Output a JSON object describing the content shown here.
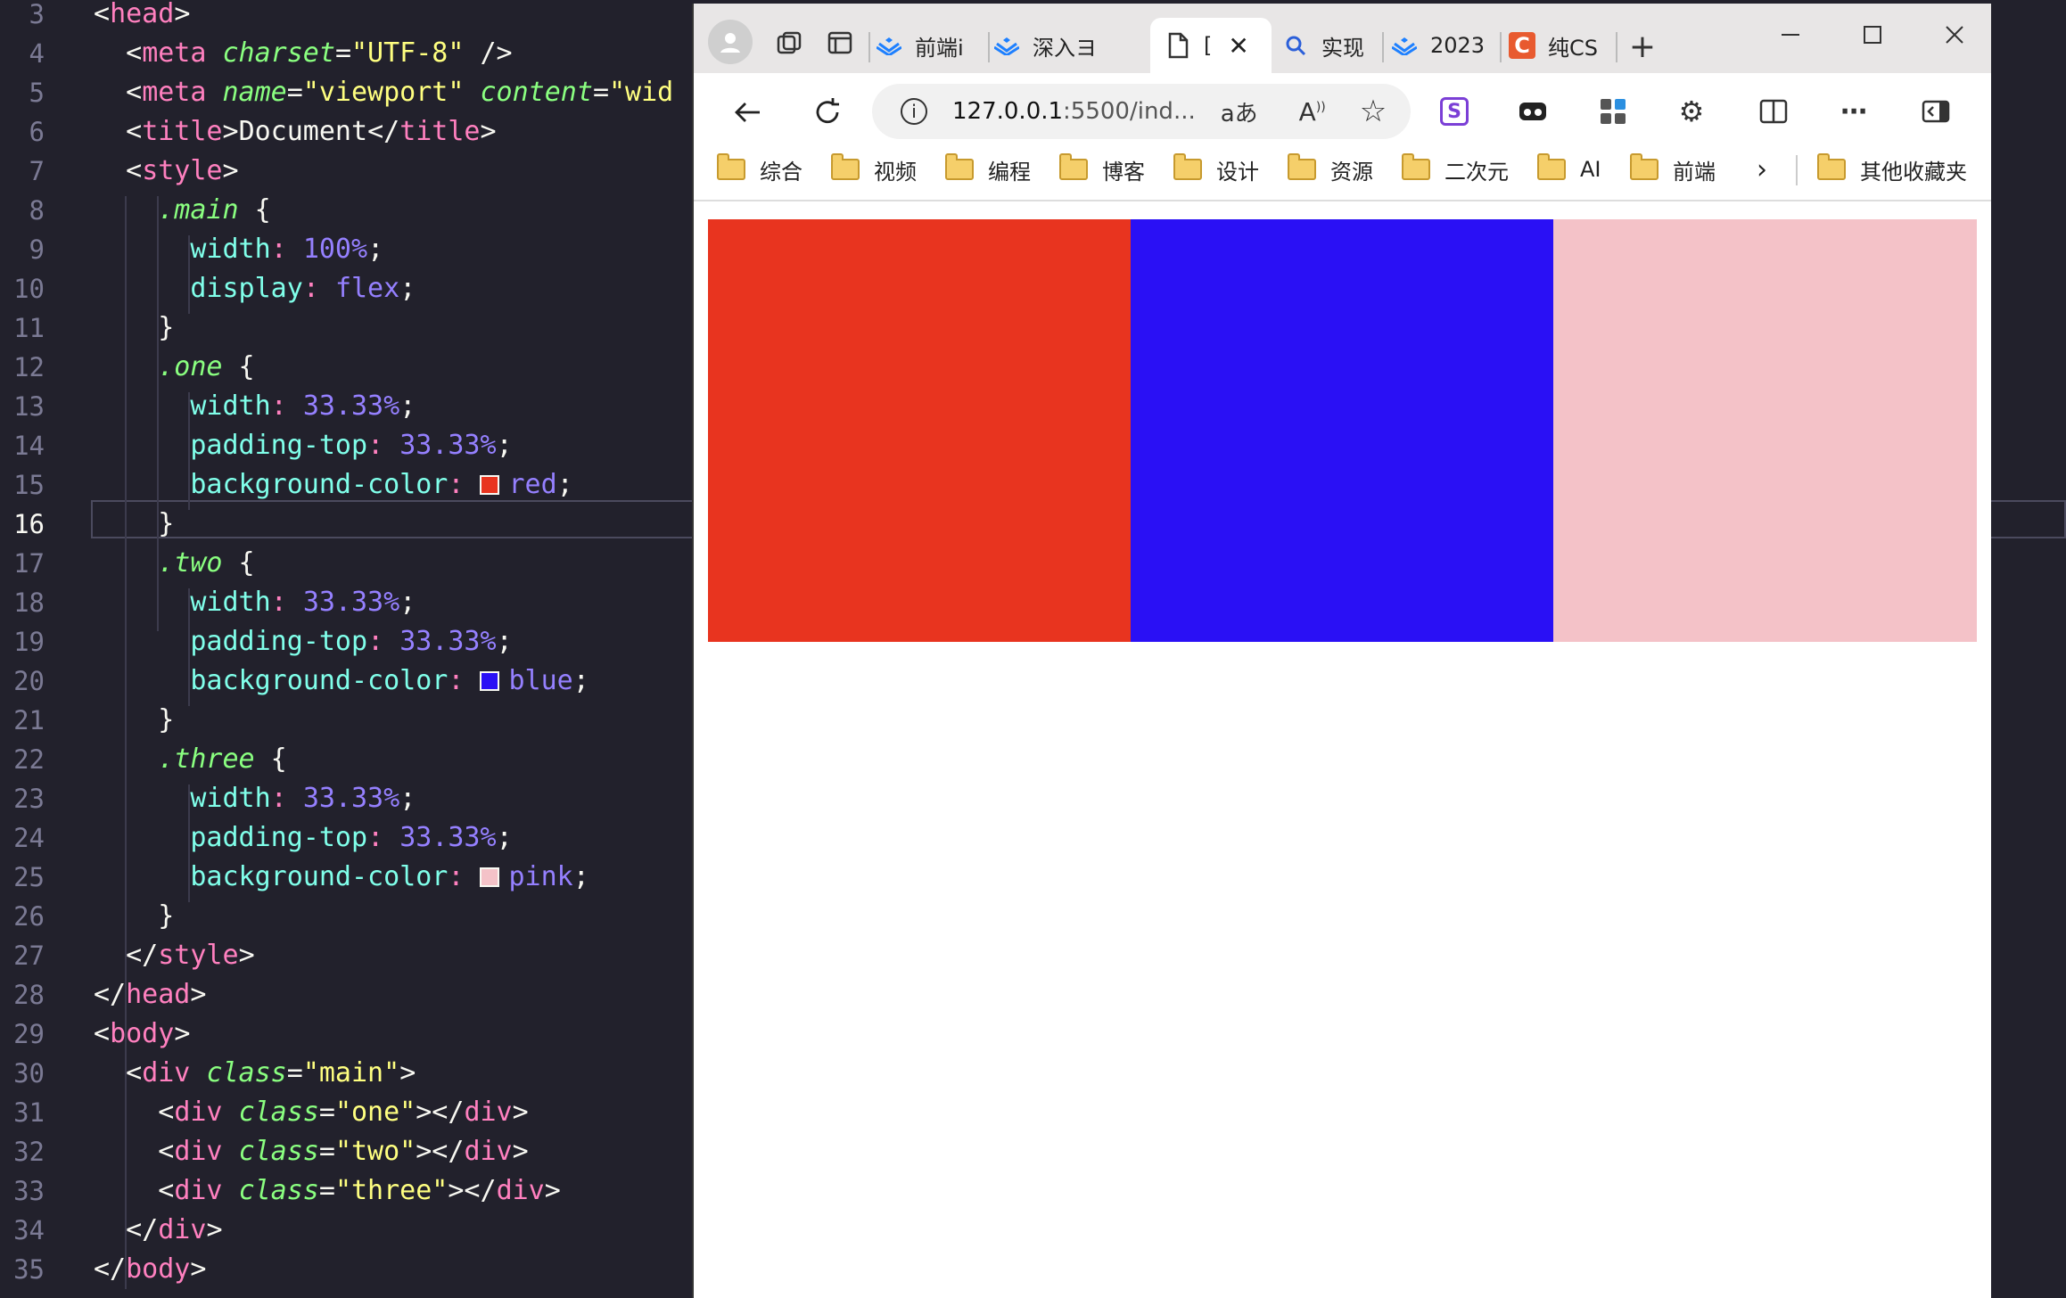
{
  "editor": {
    "lines": [
      {
        "n": "3",
        "html": "<span class='pun'>&lt;</span><span class='tag'>head</span><span class='pun'>&gt;</span>"
      },
      {
        "n": "4",
        "html": "  <span class='pun'>&lt;</span><span class='tag'>meta</span> <span class='attr'>charset</span><span class='pun'>=</span><span class='str'>\"UTF-8\"</span> <span class='pun'>/&gt;</span>"
      },
      {
        "n": "5",
        "html": "  <span class='pun'>&lt;</span><span class='tag'>meta</span> <span class='attr'>name</span><span class='pun'>=</span><span class='str'>\"viewport\"</span> <span class='attr'>content</span><span class='pun'>=</span><span class='str'>\"wid</span>"
      },
      {
        "n": "6",
        "html": "  <span class='pun'>&lt;</span><span class='tag'>title</span><span class='pun'>&gt;</span>Document<span class='pun'>&lt;/</span><span class='tag'>title</span><span class='pun'>&gt;</span>"
      },
      {
        "n": "7",
        "html": "  <span class='pun'>&lt;</span><span class='tag'>style</span><span class='pun'>&gt;</span>"
      },
      {
        "n": "8",
        "html": "    <span class='sel'>.main</span> {"
      },
      {
        "n": "9",
        "html": "      <span class='prop'>width</span><span class='tag'>:</span> <span class='num'>100%</span>;"
      },
      {
        "n": "10",
        "html": "      <span class='prop'>display</span><span class='tag'>:</span> <span class='kw'>flex</span>;"
      },
      {
        "n": "11",
        "html": "    }"
      },
      {
        "n": "12",
        "html": "    <span class='sel'>.one</span> {"
      },
      {
        "n": "13",
        "html": "      <span class='prop'>width</span><span class='tag'>:</span> <span class='num'>33.33%</span>;"
      },
      {
        "n": "14",
        "html": "      <span class='prop'>padding-top</span><span class='tag'>:</span> <span class='num'>33.33%</span>;"
      },
      {
        "n": "15",
        "html": "      <span class='prop'>background-color</span><span class='tag'>:</span> <span class='swatch' style='background:#e8341f'></span><span class='kw'>red</span>;"
      },
      {
        "n": "16",
        "html": "    }"
      },
      {
        "n": "17",
        "html": "    <span class='sel'>.two</span> {"
      },
      {
        "n": "18",
        "html": "      <span class='prop'>width</span><span class='tag'>:</span> <span class='num'>33.33%</span>;"
      },
      {
        "n": "19",
        "html": "      <span class='prop'>padding-top</span><span class='tag'>:</span> <span class='num'>33.33%</span>;"
      },
      {
        "n": "20",
        "html": "      <span class='prop'>background-color</span><span class='tag'>:</span> <span class='swatch' style='background:#2a10f5'></span><span class='kw'>blue</span>;"
      },
      {
        "n": "21",
        "html": "    }"
      },
      {
        "n": "22",
        "html": "    <span class='sel'>.three</span> {"
      },
      {
        "n": "23",
        "html": "      <span class='prop'>width</span><span class='tag'>:</span> <span class='num'>33.33%</span>;"
      },
      {
        "n": "24",
        "html": "      <span class='prop'>padding-top</span><span class='tag'>:</span> <span class='num'>33.33%</span>;"
      },
      {
        "n": "25",
        "html": "      <span class='prop'>background-color</span><span class='tag'>:</span> <span class='swatch' style='background:#f4c2c8'></span><span class='kw'>pink</span>;"
      },
      {
        "n": "26",
        "html": "    }"
      },
      {
        "n": "27",
        "html": "  <span class='pun'>&lt;/</span><span class='tag'>style</span><span class='pun'>&gt;</span>"
      },
      {
        "n": "28",
        "html": "<span class='pun'>&lt;/</span><span class='tag'>head</span><span class='pun'>&gt;</span>"
      },
      {
        "n": "29",
        "html": "<span class='pun'>&lt;</span><span class='tag'>body</span><span class='pun'>&gt;</span>"
      },
      {
        "n": "30",
        "html": "  <span class='pun'>&lt;</span><span class='tag'>div</span> <span class='attr'>class</span><span class='pun'>=</span><span class='str'>\"main\"</span><span class='pun'>&gt;</span>"
      },
      {
        "n": "31",
        "html": "    <span class='pun'>&lt;</span><span class='tag'>div</span> <span class='attr'>class</span><span class='pun'>=</span><span class='str'>\"one\"</span><span class='pun'>&gt;&lt;/</span><span class='tag'>div</span><span class='pun'>&gt;</span>"
      },
      {
        "n": "32",
        "html": "    <span class='pun'>&lt;</span><span class='tag'>div</span> <span class='attr'>class</span><span class='pun'>=</span><span class='str'>\"two\"</span><span class='pun'>&gt;&lt;/</span><span class='tag'>div</span><span class='pun'>&gt;</span>"
      },
      {
        "n": "33",
        "html": "    <span class='pun'>&lt;</span><span class='tag'>div</span> <span class='attr'>class</span><span class='pun'>=</span><span class='str'>\"three\"</span><span class='pun'>&gt;&lt;/</span><span class='tag'>div</span><span class='pun'>&gt;</span>"
      },
      {
        "n": "34",
        "html": "  <span class='pun'>&lt;/</span><span class='tag'>div</span><span class='pun'>&gt;</span>"
      },
      {
        "n": "35",
        "html": "<span class='pun'>&lt;/</span><span class='tag'>body</span><span class='pun'>&gt;</span>"
      }
    ],
    "current_line": "16"
  },
  "browser": {
    "tabs": [
      {
        "label": "前端i",
        "icon": "juejin-icon"
      },
      {
        "label": "深入ヨ",
        "icon": "juejin-icon"
      },
      {
        "label": "[",
        "icon": "document-icon",
        "active": true
      },
      {
        "label": "实现",
        "icon": "search-icon"
      },
      {
        "label": "2023",
        "icon": "juejin-icon"
      },
      {
        "label": "纯CS",
        "icon": "csdn-icon"
      }
    ],
    "url": "127.0.0.1:5500/ind...",
    "url_host": "127.0.0.1",
    "url_rest": ":5500/ind...",
    "bookmarks": [
      "综合",
      "视频",
      "编程",
      "博客",
      "设计",
      "资源",
      "二次元",
      "AI",
      "前端"
    ],
    "bookmarks_other": "其他收藏夹",
    "page_colors": {
      "one": "#e8341f",
      "two": "#2a10f5",
      "three": "#f4c2c8"
    }
  }
}
